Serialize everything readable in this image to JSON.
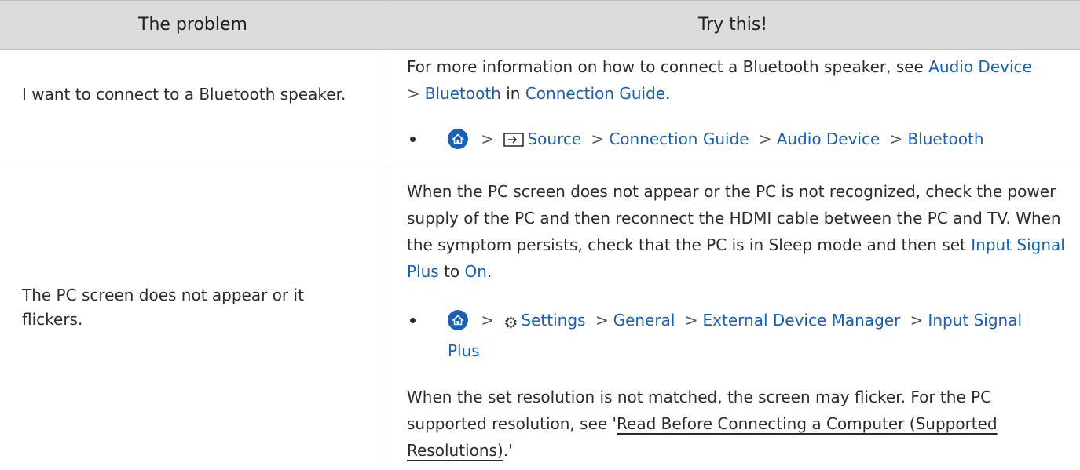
{
  "header": {
    "problem": "The problem",
    "try": "Try this!"
  },
  "rows": [
    {
      "problem": "I want to connect to a Bluetooth speaker.",
      "para_pre": "For more information on how to connect a Bluetooth speaker, see ",
      "link_audio": "Audio Device",
      "link_bluetooth": "Bluetooth",
      "word_in": " in ",
      "link_guide": "Connection Guide",
      "period": ".",
      "path": [
        "Source",
        "Connection Guide",
        "Audio Device",
        "Bluetooth"
      ]
    },
    {
      "problem": "The PC screen does not appear or it flickers.",
      "para1": "When the PC screen does not appear or the PC is not recognized, check the power supply of the PC and then reconnect the HDMI cable between the PC and TV. When the symptom persists, check that the PC is in Sleep mode and then set ",
      "link_isp": "Input Signal Plus",
      "word_to": " to ",
      "link_on": "On",
      "period": ".",
      "path": [
        "Settings",
        "General",
        "External Device Manager",
        "Input Signal",
        "Plus"
      ],
      "para2_pre": "When the set resolution is not matched, the screen may flicker. For the PC supported resolution, see '",
      "para2_link": "Read Before Connecting a Computer (Supported Resolutions)",
      "para2_post": ".'"
    }
  ],
  "icons": {
    "home": "home-icon",
    "source": "source-icon",
    "settings": "gear-icon",
    "separator": "chevron-right-icon"
  },
  "colors": {
    "link": "#1a5fb4",
    "header_bg": "#dcdcdc"
  }
}
